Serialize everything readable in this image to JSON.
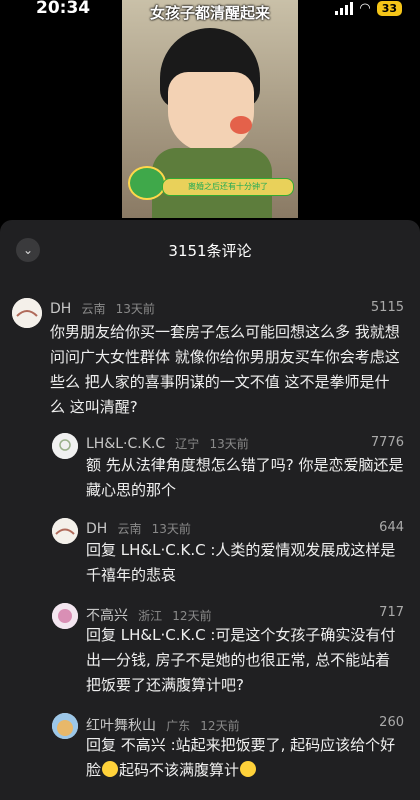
{
  "status": {
    "time": "20:34",
    "battery": "33"
  },
  "video": {
    "title": "女孩子都清醒起来",
    "caption": "离婚之后还有十分钟了"
  },
  "comments_sheet": {
    "count_label": "3151条评论",
    "comments": [
      {
        "user": "DH",
        "location": "云南",
        "time": "13天前",
        "likes": "5115",
        "text": "你男朋友给你买一套房子怎么可能回想这么多 我就想问问广大女性群体 就像你给你男朋友买车你会考虑这些么 把人家的喜事阴谋的一文不值 这不是拳师是什么 这叫清醒?"
      },
      {
        "user": "LH&L·C.K.C",
        "location": "辽宁",
        "time": "13天前",
        "likes": "7776",
        "text": "额 先从法律角度想怎么错了吗? 你是恋爱脑还是藏心思的那个"
      },
      {
        "user": "DH",
        "location": "云南",
        "time": "13天前",
        "likes": "644",
        "reply_prefix": "回复",
        "text": "LH&L·C.K.C :人类的爱情观发展成这样是千禧年的悲哀"
      },
      {
        "user": "不高兴",
        "location": "浙江",
        "time": "12天前",
        "likes": "717",
        "reply_prefix": "回复",
        "text": "LH&L·C.K.C :可是这个女孩子确实没有付出一分钱, 房子不是她的也很正常, 总不能站着把饭要了还满腹算计吧?"
      },
      {
        "user": "红叶舞秋山",
        "location": "广东",
        "time": "12天前",
        "likes": "260",
        "reply_prefix": "回复",
        "text_a": "不高兴 :站起来把饭要了, 起码应该给个好脸",
        "text_b": "起码不该满腹算计"
      }
    ]
  }
}
